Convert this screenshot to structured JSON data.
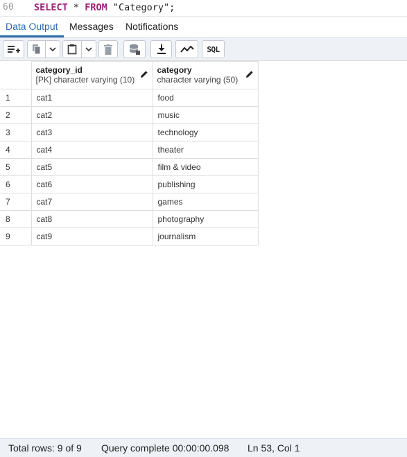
{
  "editor": {
    "line_number": "60",
    "kw_select": "SELECT",
    "star": "*",
    "kw_from": "FROM",
    "table_literal": "\"Category\";"
  },
  "tabs": [
    {
      "label": "Data Output",
      "active": true
    },
    {
      "label": "Messages",
      "active": false
    },
    {
      "label": "Notifications",
      "active": false
    }
  ],
  "toolbar": {
    "buttons": [
      "add-row-icon",
      "copy-icon",
      "copy-dropdown-icon",
      "paste-icon",
      "paste-dropdown-icon",
      "delete-icon",
      "save-data-icon",
      "download-icon",
      "graph-icon",
      "sql-icon"
    ],
    "sql_label": "SQL"
  },
  "grid": {
    "columns": [
      {
        "name": "category_id",
        "type": "[PK] character varying (10)"
      },
      {
        "name": "category",
        "type": "character varying (50)"
      }
    ],
    "rows": [
      {
        "n": "1",
        "id": "cat1",
        "category": "food"
      },
      {
        "n": "2",
        "id": "cat2",
        "category": "music"
      },
      {
        "n": "3",
        "id": "cat3",
        "category": "technology"
      },
      {
        "n": "4",
        "id": "cat4",
        "category": "theater"
      },
      {
        "n": "5",
        "id": "cat5",
        "category": "film & video"
      },
      {
        "n": "6",
        "id": "cat6",
        "category": "publishing"
      },
      {
        "n": "7",
        "id": "cat7",
        "category": "games"
      },
      {
        "n": "8",
        "id": "cat8",
        "category": "photography"
      },
      {
        "n": "9",
        "id": "cat9",
        "category": "journalism"
      }
    ]
  },
  "status": {
    "total_rows": "Total rows: 9 of 9",
    "query": "Query complete 00:00:00.098",
    "cursor": "Ln 53, Col 1"
  },
  "colors": {
    "accent": "#2a6bb1",
    "keyword": "#a0207a",
    "toolbar_bg": "#eef1f6"
  }
}
